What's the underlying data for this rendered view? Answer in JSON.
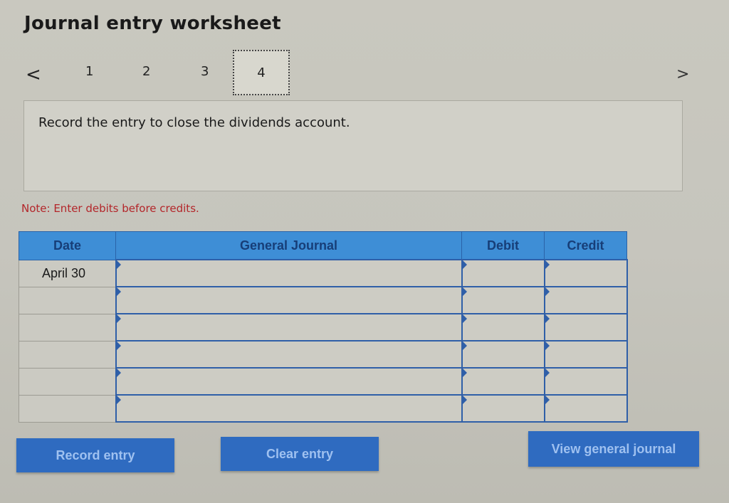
{
  "header": {
    "title": "Journal entry worksheet"
  },
  "nav": {
    "prev_icon": "chevron-left-icon",
    "next_icon": "chevron-right-icon",
    "prev_glyph": "<",
    "next_glyph": ">",
    "steps": [
      "1",
      "2",
      "3",
      "4"
    ],
    "active_step": "4"
  },
  "instruction": {
    "text": "Record the entry to close the dividends account."
  },
  "note": {
    "text": "Note: Enter debits before credits."
  },
  "journal": {
    "columns": [
      "Date",
      "General Journal",
      "Debit",
      "Credit"
    ],
    "rows": [
      {
        "date": "April 30",
        "account": "",
        "debit": "",
        "credit": ""
      },
      {
        "date": "",
        "account": "",
        "debit": "",
        "credit": ""
      },
      {
        "date": "",
        "account": "",
        "debit": "",
        "credit": ""
      },
      {
        "date": "",
        "account": "",
        "debit": "",
        "credit": ""
      },
      {
        "date": "",
        "account": "",
        "debit": "",
        "credit": ""
      },
      {
        "date": "",
        "account": "",
        "debit": "",
        "credit": ""
      }
    ]
  },
  "buttons": {
    "record": "Record entry",
    "clear": "Clear entry",
    "view": "View general journal"
  },
  "colors": {
    "accent_blue": "#2f6bc0",
    "header_blue": "#3e8ed6",
    "note_red": "#b3262a"
  }
}
